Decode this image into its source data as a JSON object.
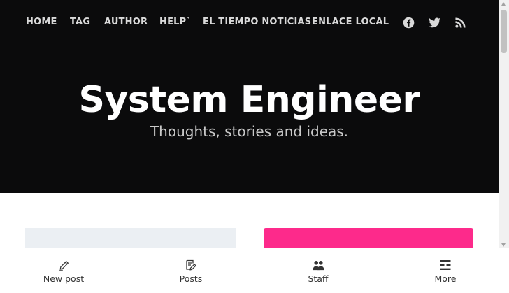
{
  "nav": {
    "items": [
      {
        "label": "HOME"
      },
      {
        "label": "TAG"
      },
      {
        "label": "AUTHOR"
      },
      {
        "label": "HELP`"
      },
      {
        "label": "EL TIEMPO NOTICIAS"
      },
      {
        "label": "ENLACE LOCAL"
      }
    ],
    "social": [
      "facebook-icon",
      "twitter-icon",
      "rss-icon"
    ]
  },
  "site": {
    "title": "System Engineer",
    "description": "Thoughts, stories and ideas."
  },
  "bottom_bar": {
    "tabs": [
      {
        "label": "New post",
        "icon": "pencil-icon"
      },
      {
        "label": "Posts",
        "icon": "document-edit-icon"
      },
      {
        "label": "Staff",
        "icon": "users-icon"
      },
      {
        "label": "More",
        "icon": "menu-icon"
      }
    ]
  },
  "colors": {
    "hero_bg": "#0b0b0c",
    "accent_card": "#fd2a8b",
    "placeholder_card": "#ebeff3"
  }
}
